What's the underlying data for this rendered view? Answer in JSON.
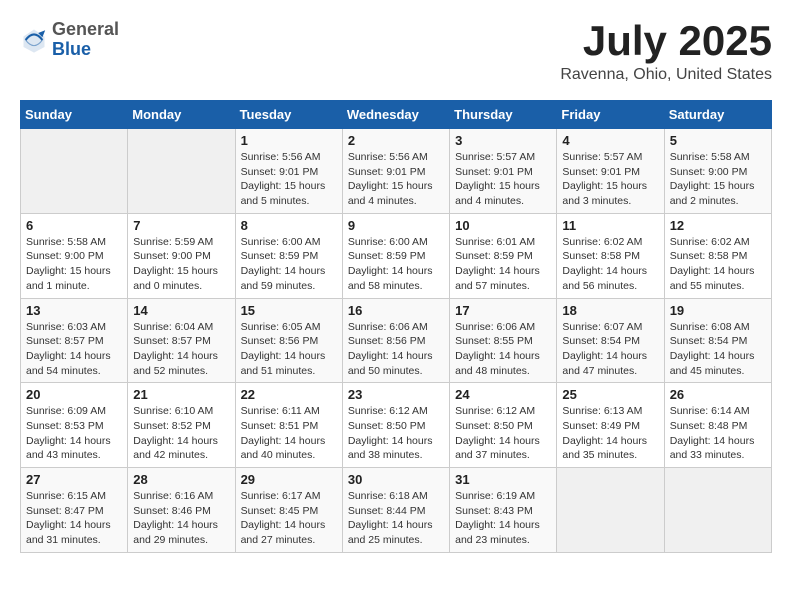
{
  "header": {
    "logo_general": "General",
    "logo_blue": "Blue",
    "month_year": "July 2025",
    "location": "Ravenna, Ohio, United States"
  },
  "weekdays": [
    "Sunday",
    "Monday",
    "Tuesday",
    "Wednesday",
    "Thursday",
    "Friday",
    "Saturday"
  ],
  "weeks": [
    [
      {
        "day": "",
        "empty": true
      },
      {
        "day": "",
        "empty": true
      },
      {
        "day": "1",
        "sunrise": "5:56 AM",
        "sunset": "9:01 PM",
        "daylight": "15 hours and 5 minutes."
      },
      {
        "day": "2",
        "sunrise": "5:56 AM",
        "sunset": "9:01 PM",
        "daylight": "15 hours and 4 minutes."
      },
      {
        "day": "3",
        "sunrise": "5:57 AM",
        "sunset": "9:01 PM",
        "daylight": "15 hours and 4 minutes."
      },
      {
        "day": "4",
        "sunrise": "5:57 AM",
        "sunset": "9:01 PM",
        "daylight": "15 hours and 3 minutes."
      },
      {
        "day": "5",
        "sunrise": "5:58 AM",
        "sunset": "9:00 PM",
        "daylight": "15 hours and 2 minutes."
      }
    ],
    [
      {
        "day": "6",
        "sunrise": "5:58 AM",
        "sunset": "9:00 PM",
        "daylight": "15 hours and 1 minute."
      },
      {
        "day": "7",
        "sunrise": "5:59 AM",
        "sunset": "9:00 PM",
        "daylight": "15 hours and 0 minutes."
      },
      {
        "day": "8",
        "sunrise": "6:00 AM",
        "sunset": "8:59 PM",
        "daylight": "14 hours and 59 minutes."
      },
      {
        "day": "9",
        "sunrise": "6:00 AM",
        "sunset": "8:59 PM",
        "daylight": "14 hours and 58 minutes."
      },
      {
        "day": "10",
        "sunrise": "6:01 AM",
        "sunset": "8:59 PM",
        "daylight": "14 hours and 57 minutes."
      },
      {
        "day": "11",
        "sunrise": "6:02 AM",
        "sunset": "8:58 PM",
        "daylight": "14 hours and 56 minutes."
      },
      {
        "day": "12",
        "sunrise": "6:02 AM",
        "sunset": "8:58 PM",
        "daylight": "14 hours and 55 minutes."
      }
    ],
    [
      {
        "day": "13",
        "sunrise": "6:03 AM",
        "sunset": "8:57 PM",
        "daylight": "14 hours and 54 minutes."
      },
      {
        "day": "14",
        "sunrise": "6:04 AM",
        "sunset": "8:57 PM",
        "daylight": "14 hours and 52 minutes."
      },
      {
        "day": "15",
        "sunrise": "6:05 AM",
        "sunset": "8:56 PM",
        "daylight": "14 hours and 51 minutes."
      },
      {
        "day": "16",
        "sunrise": "6:06 AM",
        "sunset": "8:56 PM",
        "daylight": "14 hours and 50 minutes."
      },
      {
        "day": "17",
        "sunrise": "6:06 AM",
        "sunset": "8:55 PM",
        "daylight": "14 hours and 48 minutes."
      },
      {
        "day": "18",
        "sunrise": "6:07 AM",
        "sunset": "8:54 PM",
        "daylight": "14 hours and 47 minutes."
      },
      {
        "day": "19",
        "sunrise": "6:08 AM",
        "sunset": "8:54 PM",
        "daylight": "14 hours and 45 minutes."
      }
    ],
    [
      {
        "day": "20",
        "sunrise": "6:09 AM",
        "sunset": "8:53 PM",
        "daylight": "14 hours and 43 minutes."
      },
      {
        "day": "21",
        "sunrise": "6:10 AM",
        "sunset": "8:52 PM",
        "daylight": "14 hours and 42 minutes."
      },
      {
        "day": "22",
        "sunrise": "6:11 AM",
        "sunset": "8:51 PM",
        "daylight": "14 hours and 40 minutes."
      },
      {
        "day": "23",
        "sunrise": "6:12 AM",
        "sunset": "8:50 PM",
        "daylight": "14 hours and 38 minutes."
      },
      {
        "day": "24",
        "sunrise": "6:12 AM",
        "sunset": "8:50 PM",
        "daylight": "14 hours and 37 minutes."
      },
      {
        "day": "25",
        "sunrise": "6:13 AM",
        "sunset": "8:49 PM",
        "daylight": "14 hours and 35 minutes."
      },
      {
        "day": "26",
        "sunrise": "6:14 AM",
        "sunset": "8:48 PM",
        "daylight": "14 hours and 33 minutes."
      }
    ],
    [
      {
        "day": "27",
        "sunrise": "6:15 AM",
        "sunset": "8:47 PM",
        "daylight": "14 hours and 31 minutes."
      },
      {
        "day": "28",
        "sunrise": "6:16 AM",
        "sunset": "8:46 PM",
        "daylight": "14 hours and 29 minutes."
      },
      {
        "day": "29",
        "sunrise": "6:17 AM",
        "sunset": "8:45 PM",
        "daylight": "14 hours and 27 minutes."
      },
      {
        "day": "30",
        "sunrise": "6:18 AM",
        "sunset": "8:44 PM",
        "daylight": "14 hours and 25 minutes."
      },
      {
        "day": "31",
        "sunrise": "6:19 AM",
        "sunset": "8:43 PM",
        "daylight": "14 hours and 23 minutes."
      },
      {
        "day": "",
        "empty": true
      },
      {
        "day": "",
        "empty": true
      }
    ]
  ],
  "labels": {
    "sunrise": "Sunrise:",
    "sunset": "Sunset:",
    "daylight": "Daylight:"
  }
}
